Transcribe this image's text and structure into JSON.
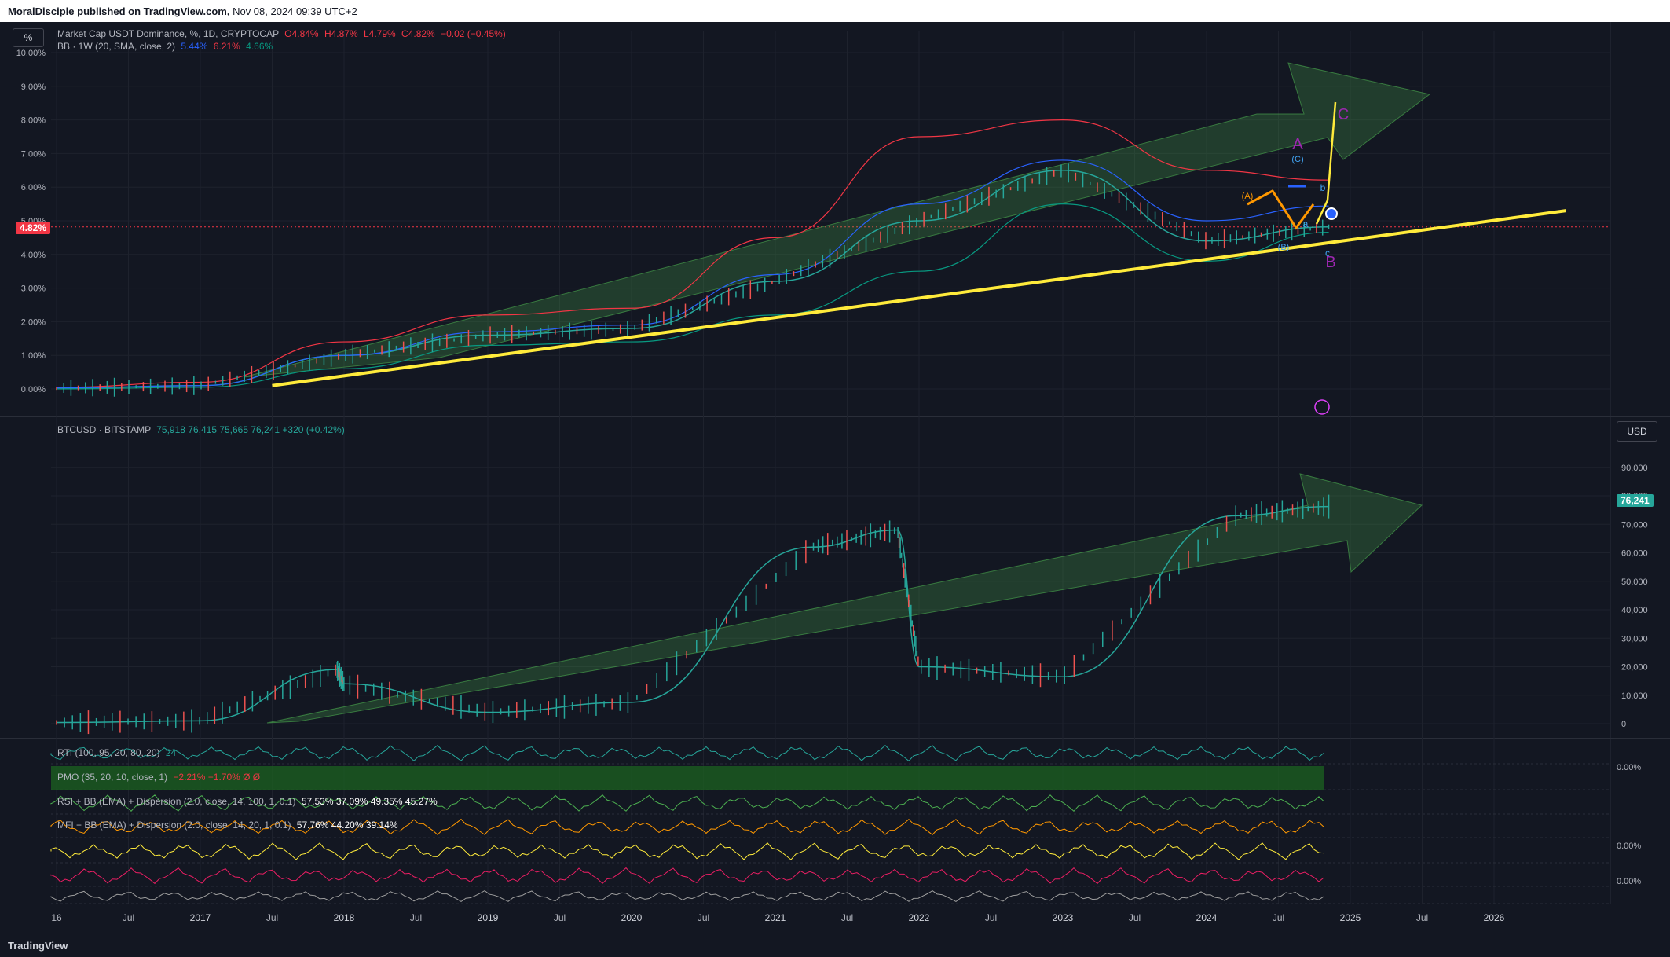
{
  "header": {
    "publisher": "MoralDisciple published on TradingView.com,",
    "datetime": "Nov 08, 2024 09:39 UTC+2"
  },
  "upper_pane": {
    "scale_button": "%",
    "symbol_line": "Market Cap USDT Dominance, %, 1D, CRYPTOCAP",
    "ohlc": {
      "o": "O4.84%",
      "h": "H4.87%",
      "l": "L4.79%",
      "c": "C4.82%",
      "chg": "−0.02 (−0.45%)"
    },
    "bb_line": "BB · 1W (20, SMA, close, 2)",
    "bb_values": [
      "5.44%",
      "6.21%",
      "4.66%"
    ],
    "current_value": "4.82%",
    "wave_labels": {
      "A": "A",
      "B": "B",
      "C": "C",
      "sub_A": "(A)",
      "sub_B": "(B)",
      "sub_C": "(C)",
      "a": "a",
      "b": "b",
      "c": "c"
    }
  },
  "lower_pane": {
    "symbol_line": "BTCUSD · BITSTAMP",
    "values": "75,918  76,415  75,665  76,241  +320 (+0.42%)",
    "currency_button": "USD",
    "current_value": "76,241"
  },
  "indicators": [
    {
      "label": "RTI (100, 95, 20, 80, 20)",
      "value": "24"
    },
    {
      "label": "PMO (35, 20, 10, close, 1)",
      "value": "−2.21%  −1.70%  Ø  Ø"
    },
    {
      "label": "RSI + BB (EMA) + Dispersion (2.0, close, 14, 100, 1, 0.1)",
      "value": "57.53%  37.09%  49.35%  45.27%"
    },
    {
      "label": "MFI + BB (EMA) + Dispersion (2.0, close, 14, 20, 1, 0.1)",
      "value": "57.76%  44.20%  39.14%"
    }
  ],
  "indicator_axis": [
    "0.00%",
    "0.00%",
    "0.00%"
  ],
  "brand": "TradingView",
  "colors": {
    "bg": "#131722",
    "grid": "#1e222d",
    "yellow": "#ffeb3b",
    "arrow": "#4caf50",
    "bb_upper": "#f23645",
    "bb_basis": "#2962ff",
    "bb_lower": "#089981",
    "up": "#26a69a",
    "down": "#ef5350",
    "purple": "#9c27b0",
    "orange": "#ff9800"
  },
  "chart_data": [
    {
      "type": "line",
      "title": "Market Cap USDT Dominance, %, 1D",
      "x": [
        "2016",
        "2017",
        "2018",
        "2019",
        "2020",
        "2021",
        "2022",
        "2023",
        "2024",
        "2024-Nov"
      ],
      "series": [
        {
          "name": "Market Cap USDT Dominance",
          "values": [
            0.02,
            0.1,
            1.0,
            1.6,
            1.8,
            3.2,
            5.0,
            6.5,
            4.4,
            4.82
          ]
        },
        {
          "name": "BB upper",
          "values": [
            0.05,
            0.2,
            1.4,
            2.2,
            2.4,
            4.5,
            7.5,
            8.0,
            6.5,
            6.21
          ]
        },
        {
          "name": "BB basis",
          "values": [
            0.03,
            0.1,
            1.0,
            1.7,
            1.9,
            3.4,
            5.5,
            6.8,
            5.0,
            5.44
          ]
        },
        {
          "name": "BB lower",
          "values": [
            0.0,
            0.05,
            0.6,
            1.3,
            1.4,
            2.2,
            3.5,
            5.5,
            3.8,
            4.66
          ]
        }
      ],
      "ylim": [
        0,
        10
      ],
      "y_ticks": [
        "0.00%",
        "1.00%",
        "2.00%",
        "3.00%",
        "4.00%",
        "5.00%",
        "6.00%",
        "7.00%",
        "8.00%",
        "9.00%",
        "10.00%"
      ],
      "trendline": {
        "from": [
          "2017-Jul",
          0.1
        ],
        "to": [
          "2026-Jul",
          5.3
        ]
      }
    },
    {
      "type": "line",
      "title": "BTCUSD · BITSTAMP",
      "x": [
        "2016",
        "2017",
        "2017-Dec",
        "2018",
        "2019",
        "2020",
        "2021-Apr",
        "2021-Nov",
        "2022",
        "2023",
        "2024-Mar",
        "2024-Nov"
      ],
      "series": [
        {
          "name": "BTCUSD",
          "values": [
            400,
            1000,
            19000,
            14000,
            4000,
            7500,
            62000,
            68000,
            20000,
            16500,
            73000,
            76241
          ]
        }
      ],
      "ylim": [
        0,
        95000
      ],
      "y_ticks": [
        "0",
        "10,000",
        "20,000",
        "30,000",
        "40,000",
        "50,000",
        "60,000",
        "70,000",
        "80,000",
        "90,000"
      ]
    }
  ],
  "x_axis_labels": [
    "16",
    "Jul",
    "2017",
    "Jul",
    "2018",
    "Jul",
    "2019",
    "Jul",
    "2020",
    "Jul",
    "2021",
    "Jul",
    "2022",
    "Jul",
    "2023",
    "Jul",
    "2024",
    "Jul",
    "2025",
    "Jul",
    "2026"
  ]
}
